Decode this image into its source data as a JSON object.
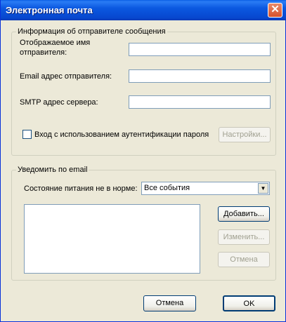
{
  "window": {
    "title": "Электронная почта",
    "close_glyph": "✕"
  },
  "sender_group": {
    "legend": "Информация об отправителе сообщения",
    "display_name_label": "Отображаемое имя отправителя:",
    "display_name_value": "",
    "email_label": "Email адрес отправителя:",
    "email_value": "",
    "smtp_label": "SMTP адрес сервера:",
    "smtp_value": "",
    "auth_checkbox_label": "Вход с использованием аутентификации пароля",
    "auth_checked": false,
    "settings_button": "Настройки..."
  },
  "notify_group": {
    "legend": "Уведомить по email",
    "power_state_label": "Состояние питания не в норме:",
    "power_state_selected": "Все события",
    "recipients": [],
    "add_button": "Добавить...",
    "edit_button": "Изменить...",
    "cancel_item_button": "Отмена"
  },
  "footer": {
    "cancel_button": "Отмена",
    "ok_button": "OK"
  }
}
